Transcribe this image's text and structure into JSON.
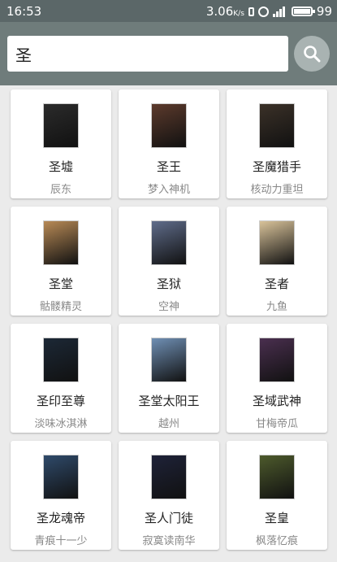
{
  "status_bar": {
    "time": "16:53",
    "speed": "3.06",
    "speed_unit": "K/s",
    "battery": "99"
  },
  "search": {
    "value": "圣"
  },
  "books": [
    {
      "title": "圣墟",
      "author": "辰东",
      "cover_color": "#2b2b2b"
    },
    {
      "title": "圣王",
      "author": "梦入神机",
      "cover_color": "#5c3a2c"
    },
    {
      "title": "圣魔猎手",
      "author": "核动力重坦",
      "cover_color": "#3b3128"
    },
    {
      "title": "圣堂",
      "author": "骷髅精灵",
      "cover_color": "#b88a56"
    },
    {
      "title": "圣狱",
      "author": "空神",
      "cover_color": "#5f6c8a"
    },
    {
      "title": "圣者",
      "author": "九鱼",
      "cover_color": "#d9c39a"
    },
    {
      "title": "圣印至尊",
      "author": "淡味冰淇淋",
      "cover_color": "#1c2836"
    },
    {
      "title": "圣堂太阳王",
      "author": "越州",
      "cover_color": "#6f8fb4"
    },
    {
      "title": "圣域武神",
      "author": "甘梅帝瓜",
      "cover_color": "#4a2f4f"
    },
    {
      "title": "圣龙魂帝",
      "author": "青痕十一少",
      "cover_color": "#2f4a6a"
    },
    {
      "title": "圣人门徒",
      "author": "寂寞读南华",
      "cover_color": "#1e2238"
    },
    {
      "title": "圣皇",
      "author": "枫落忆痕",
      "cover_color": "#4d5a2c"
    }
  ]
}
